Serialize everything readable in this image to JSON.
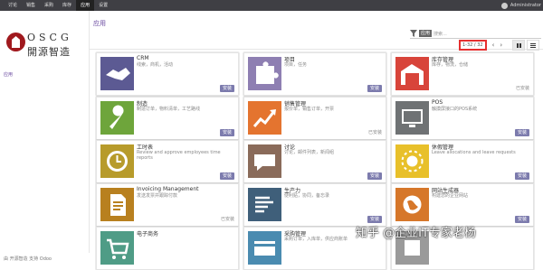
{
  "topbar": {
    "menu": [
      "讨论",
      "销售",
      "采购",
      "库存",
      "应用",
      "设置"
    ],
    "active_index": 4,
    "user": "Administrator"
  },
  "sidebar": {
    "logo_en": "OSCG",
    "logo_cn": "開源智造",
    "section": "应用",
    "footer": "由 开源智造 支持 Odoo"
  },
  "control": {
    "breadcrumb": "应用",
    "search_facet": "应用",
    "search_placeholder": "搜索...",
    "pager": "1-32 / 32",
    "prev": "‹",
    "next": "›"
  },
  "cards": [
    {
      "name": "CRM",
      "desc": "线索，商机，活动",
      "action": "安装",
      "installed": false,
      "icon": "handshake-icon",
      "color": "#5c5a93"
    },
    {
      "name": "项目",
      "desc": "项目，任务",
      "action": "安装",
      "installed": false,
      "icon": "puzzle-icon",
      "color": "#8e7fb2"
    },
    {
      "name": "库存管理",
      "desc": "库存，物流，仓储",
      "action": "已安装",
      "installed": true,
      "icon": "warehouse-icon",
      "color": "#d8443a"
    },
    {
      "name": "制造",
      "desc": "制造订单，物料清单，工艺路线",
      "action": "安装",
      "installed": false,
      "icon": "wrench-icon",
      "color": "#6ea53b"
    },
    {
      "name": "销售管理",
      "desc": "报价单，销售订单，开票",
      "action": "已安装",
      "installed": true,
      "icon": "chart-up-icon",
      "color": "#e4742f"
    },
    {
      "name": "POS",
      "desc": "触摸屏接口的POS系统",
      "action": "安装",
      "installed": false,
      "icon": "monitor-icon",
      "color": "#6f7274"
    },
    {
      "name": "工时表",
      "desc": "Review and approve employees time reports",
      "action": "安装",
      "installed": false,
      "icon": "clock-icon",
      "color": "#b79b2b"
    },
    {
      "name": "讨论",
      "desc": "讨论，邮件列表，新闻组",
      "action": "安装",
      "installed": false,
      "icon": "chat-icon",
      "color": "#8a6b5a"
    },
    {
      "name": "休假管理",
      "desc": "Leave allocations and leave requests",
      "action": "安装",
      "installed": false,
      "icon": "sun-icon",
      "color": "#e8c02a"
    },
    {
      "name": "Invoicing Management",
      "desc": "发送发票并跟踪付款",
      "action": "已安装",
      "installed": true,
      "icon": "invoice-icon",
      "color": "#b8801f"
    },
    {
      "name": "生产力",
      "desc": "便利贴，协同，备忘录",
      "action": "安装",
      "installed": false,
      "icon": "notes-icon",
      "color": "#3f5f7a"
    },
    {
      "name": "网站生成器",
      "desc": "构建您的企业网站",
      "action": "安装",
      "installed": false,
      "icon": "globe-icon",
      "color": "#d6772a"
    },
    {
      "name": "电子商务",
      "desc": "",
      "action": "",
      "installed": false,
      "icon": "cart-icon",
      "color": "#4f9c86"
    },
    {
      "name": "采购管理",
      "desc": "采购订单，入库单，供应商账单",
      "action": "",
      "installed": false,
      "icon": "card-icon",
      "color": "#4a8bb0"
    },
    {
      "name": "",
      "desc": "",
      "action": "",
      "installed": false,
      "icon": "app-icon",
      "color": "#9a9a9a"
    }
  ],
  "watermark": "知乎 @企业IT专家老杨"
}
